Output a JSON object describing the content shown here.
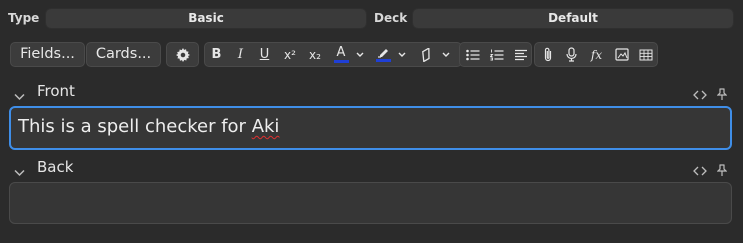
{
  "header": {
    "type_label": "Type",
    "type_value": "Basic",
    "deck_label": "Deck",
    "deck_value": "Default"
  },
  "toolbar": {
    "fields_label": "Fields...",
    "cards_label": "Cards...",
    "buttons": [
      "gear-icon",
      "bold-icon",
      "italic-icon",
      "underline-icon",
      "superscript-icon",
      "subscript-icon",
      "text-color-icon",
      "highlight-color-icon",
      "eraser-icon",
      "unordered-list-icon",
      "ordered-list-icon",
      "align-icon",
      "attachment-icon",
      "microphone-icon",
      "function-icon",
      "image-occlusion-icon",
      "table-icon"
    ],
    "bold": "B",
    "italic": "I",
    "underline": "U",
    "superscript": "x²",
    "subscript": "x₂",
    "text_color_letter": "A",
    "text_color": "#1f3fd6",
    "highlight_color": "#1f3fd6",
    "function_glyph": "fx"
  },
  "fields": [
    {
      "name": "Front",
      "content_before": "This is a spell checker for ",
      "content_misspelled": "Aki",
      "focused": true
    },
    {
      "name": "Back",
      "content": "",
      "focused": false
    }
  ],
  "colors": {
    "background": "#2b2b2b",
    "focus_border": "#3f8ee8",
    "spell_error": "#e03030"
  }
}
